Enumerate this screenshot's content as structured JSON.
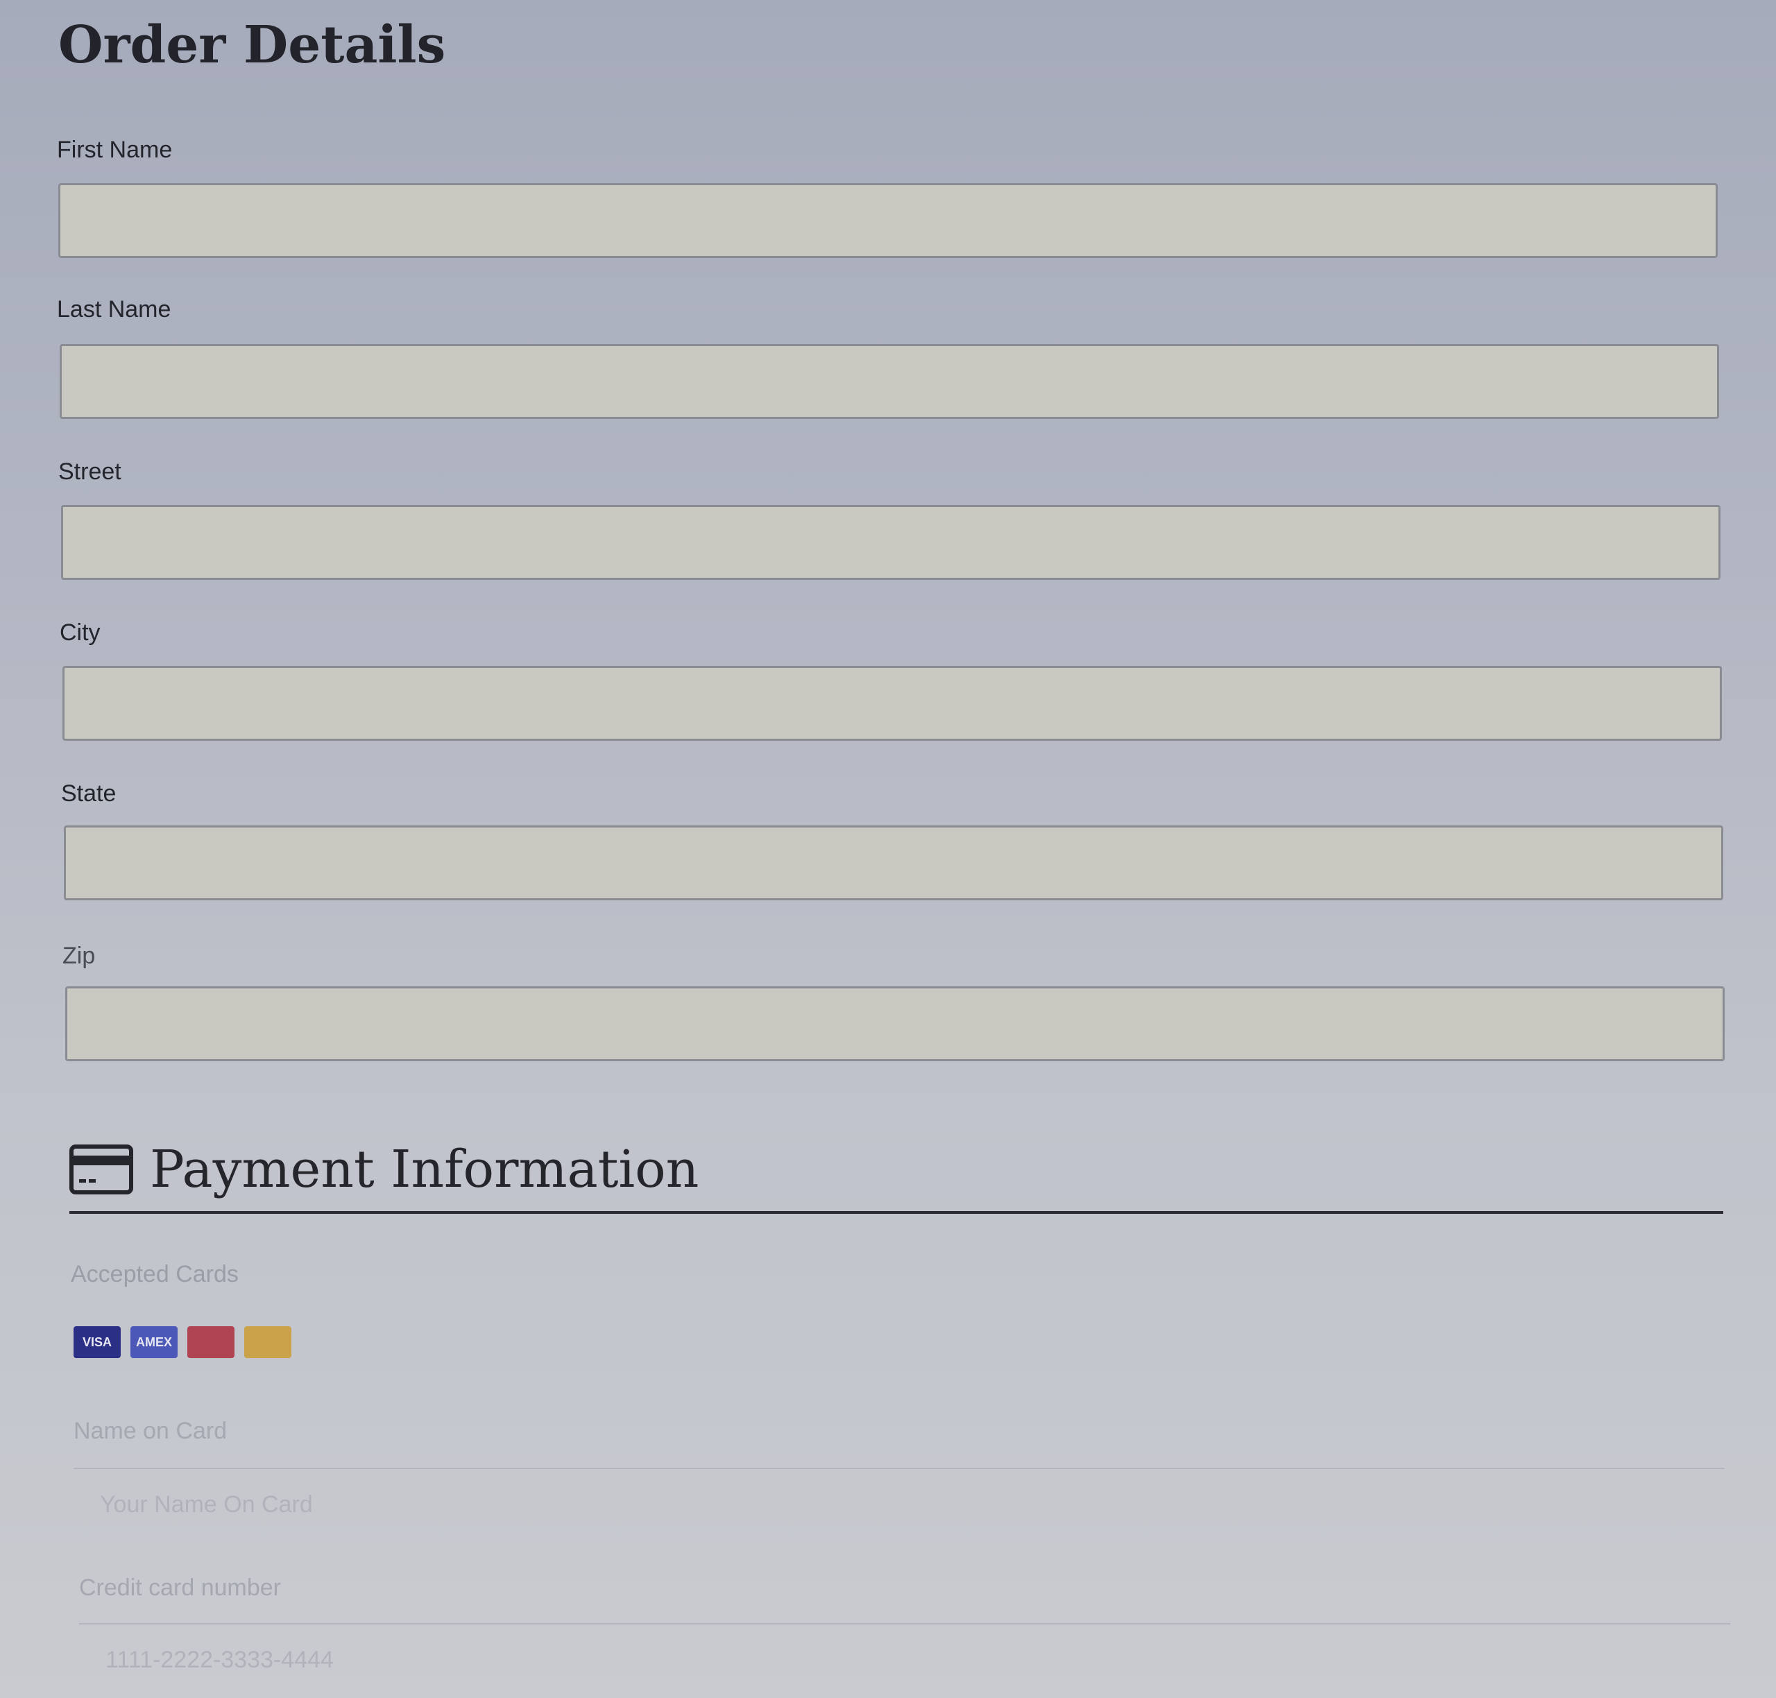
{
  "heading": "Order Details",
  "fields": {
    "first_name": {
      "label": "First Name",
      "value": ""
    },
    "last_name": {
      "label": "Last Name",
      "value": ""
    },
    "street": {
      "label": "Street",
      "value": ""
    },
    "city": {
      "label": "City",
      "value": ""
    },
    "state": {
      "label": "State",
      "value": ""
    },
    "zip": {
      "label": "Zip",
      "value": ""
    }
  },
  "payment": {
    "title": "Payment Information",
    "icon": "credit-card-icon",
    "accepted_label": "Accepted Cards",
    "cards": [
      {
        "name": "visa-card-icon",
        "text": "VISA",
        "color": "#2c2f86"
      },
      {
        "name": "amex-card-icon",
        "text": "AMEX",
        "color": "#4b58b8"
      },
      {
        "name": "discover-card-icon",
        "text": "",
        "color": "#b04452"
      },
      {
        "name": "mastercard-card-icon",
        "text": "",
        "color": "#c9a24a"
      }
    ],
    "name_on_card": {
      "label": "Name on Card",
      "placeholder": "Your Name On Card"
    },
    "card_number": {
      "label": "Credit card number",
      "placeholder": "1111-2222-3333-4444"
    }
  }
}
